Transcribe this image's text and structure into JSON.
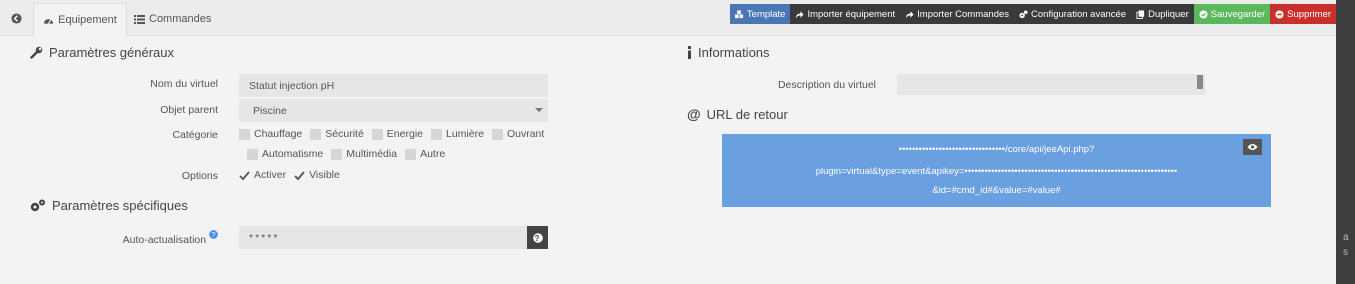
{
  "tabs": {
    "equipment": "Equipement",
    "commands": "Commandes"
  },
  "actions": {
    "template": "Template",
    "import_equipment": "Importer équipement",
    "import_commands": "Importer Commandes",
    "advanced_config": "Configuration avancée",
    "duplicate": "Dupliquer",
    "save": "Sauvegarder",
    "delete": "Supprimer"
  },
  "general": {
    "title": "Paramètres généraux",
    "name_label": "Nom du virtuel",
    "name_value": "Statut injection pH",
    "parent_label": "Objet parent",
    "parent_value": "Piscine",
    "category_label": "Catégorie",
    "categories": [
      "Chauffage",
      "Sécurité",
      "Energie",
      "Lumière",
      "Ouvrant",
      "Automatisme",
      "Multimédia",
      "Autre"
    ],
    "options_label": "Options",
    "options": [
      "Activer",
      "Visible"
    ]
  },
  "specific": {
    "title": "Paramètres spécifiques",
    "auto_refresh_label": "Auto-actualisation",
    "auto_refresh_value": "*****"
  },
  "info": {
    "title": "Informations",
    "description_label": "Description du virtuel",
    "description_value": ""
  },
  "return_url": {
    "title": "URL de retour",
    "line1": "••••••••••••••••••••••••••••••••/core/api/jeeApi.php?",
    "line2": "plugin=virtual&type=event&apikey=••••••••••••••••••••••••••••••••••••••••••••••••••••••••••••••••",
    "line3": "&id=#cmd_id#&value=#value#"
  },
  "edge_text": [
    "a",
    "s"
  ],
  "colors": {
    "template": "#4a77b4",
    "save": "#5cb85c",
    "delete": "#c9302c",
    "url_box": "#6a9fe0"
  }
}
